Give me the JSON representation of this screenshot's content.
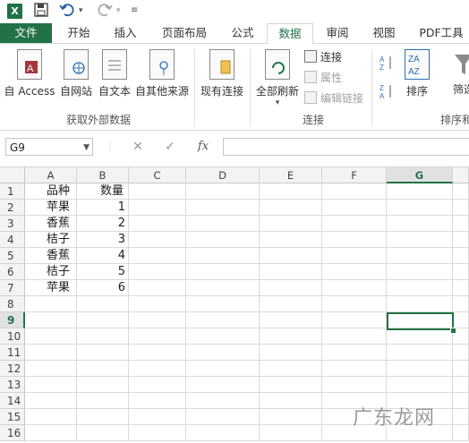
{
  "qat": {
    "excel_icon_label": "X"
  },
  "tabs": [
    "文件",
    "开始",
    "插入",
    "页面布局",
    "公式",
    "数据",
    "审阅",
    "视图",
    "PDF工具"
  ],
  "ribbon": {
    "groups": [
      {
        "label": "获取外部数据",
        "buttons": [
          "自 Access",
          "自网站",
          "自文本",
          "自其他来源"
        ]
      },
      {
        "label": "",
        "buttons": [
          "现有连接"
        ]
      },
      {
        "label": "连接",
        "buttons": [
          "全部刷新"
        ],
        "small": [
          "连接",
          "属性",
          "编辑链接"
        ]
      },
      {
        "label": "排序和",
        "buttons": [
          "排序",
          "筛选"
        ]
      }
    ]
  },
  "formula_bar": {
    "name_box": "G9",
    "fx": "fx",
    "cancel": "✕",
    "enter": "✓",
    "value": ""
  },
  "columns": [
    "A",
    "B",
    "C",
    "D",
    "E",
    "F",
    "G"
  ],
  "selected_column": "G",
  "rows": [
    "1",
    "2",
    "3",
    "4",
    "5",
    "6",
    "7",
    "8",
    "9",
    "10",
    "11",
    "12",
    "13",
    "14",
    "15",
    "16"
  ],
  "selected_row": "9",
  "cells": [
    [
      "品种",
      "数量"
    ],
    [
      "苹果",
      "1"
    ],
    [
      "香蕉",
      "2"
    ],
    [
      "桔子",
      "3"
    ],
    [
      "香蕉",
      "4"
    ],
    [
      "桔子",
      "5"
    ],
    [
      "苹果",
      "6"
    ]
  ],
  "watermark": "广东龙网",
  "colors": {
    "accent": "#217346",
    "file_tab": "#217346"
  }
}
